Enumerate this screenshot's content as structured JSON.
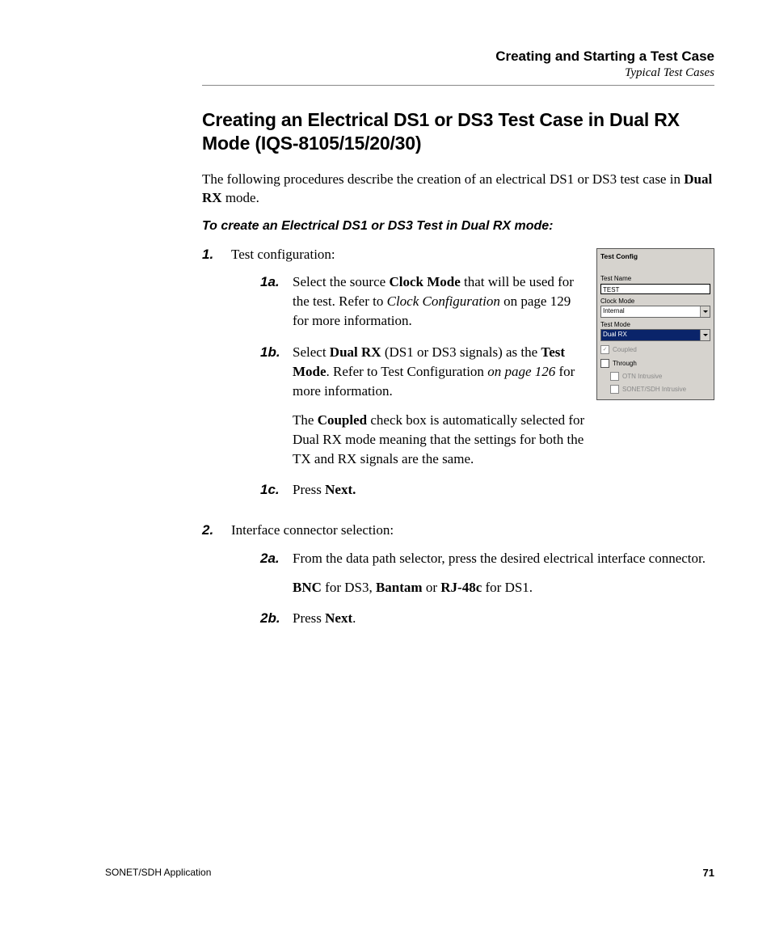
{
  "header": {
    "chapter": "Creating and Starting a Test Case",
    "sub": "Typical Test Cases"
  },
  "section_title": "Creating an Electrical DS1 or DS3 Test Case in Dual RX Mode (IQS-8105/15/20/30)",
  "intro_pre": "The following procedures describe the creation of an electrical DS1 or DS3 test case in ",
  "intro_bold": "Dual RX",
  "intro_post": " mode.",
  "subhead": "To create an Electrical DS1 or DS3 Test in Dual RX mode:",
  "figure": {
    "title": "Test Config",
    "test_name_label": "Test Name",
    "test_name_value": "TEST",
    "clock_mode_label": "Clock Mode",
    "clock_mode_value": "Internal",
    "test_mode_label": "Test Mode",
    "test_mode_value": "Dual RX",
    "coupled_label": "Coupled",
    "through_label": "Through",
    "otn_label": "OTN Intrusive",
    "sonet_label": "SONET/SDH Intrusive"
  },
  "steps": {
    "s1": {
      "num": "1.",
      "text": "Test configuration:",
      "a": {
        "num": "1a.",
        "t1": "Select the source ",
        "b1": "Clock Mode",
        "t2": " that will be used for the test. Refer to ",
        "i1": "Clock Configuration",
        "t3": " on page 129 for more information."
      },
      "b": {
        "num": "1b.",
        "t1": "Select ",
        "b1": "Dual RX",
        "t2": " (DS1 or DS3 signals) as the ",
        "b2": "Test Mode",
        "t3": ". Refer to Test Configuration ",
        "i1": "on page 126",
        "t4": " for more information.",
        "p2a": "The ",
        "p2b": "Coupled",
        "p2c": " check box is automatically selected for Dual RX mode meaning that the settings for both the TX and RX signals are the same."
      },
      "c": {
        "num": "1c.",
        "t1": "Press ",
        "b1": "Next."
      }
    },
    "s2": {
      "num": "2.",
      "text": "Interface connector selection:",
      "a": {
        "num": "2a.",
        "t1": "From the data path selector, press the desired electrical interface connector.",
        "p2_b1": "BNC",
        "p2_t1": " for DS3, ",
        "p2_b2": "Bantam",
        "p2_t2": " or ",
        "p2_b3": "RJ-48c",
        "p2_t3": " for DS1."
      },
      "b": {
        "num": "2b.",
        "t1": "Press ",
        "b1": "Next",
        "t2": "."
      }
    }
  },
  "footer": {
    "left": "SONET/SDH Application",
    "page": "71"
  }
}
